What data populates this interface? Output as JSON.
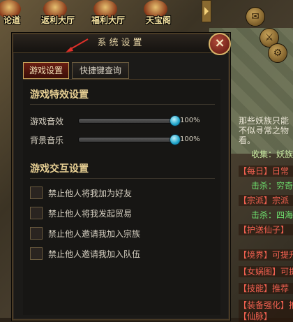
{
  "top_menu": {
    "items": [
      {
        "label": "论道"
      },
      {
        "label": "返利大厅"
      },
      {
        "label": "福利大厅"
      },
      {
        "label": "天宝阁"
      }
    ]
  },
  "side_panel": {
    "lines": [
      {
        "text": "那些妖族只能",
        "color": "#e9e4d4"
      },
      {
        "text": "不似寻常之物",
        "color": "#e9e4d4"
      },
      {
        "text": "看。",
        "color": "#e9e4d4"
      },
      {
        "text": "收集：妖族",
        "color": "#c8e8a0"
      },
      {
        "text": "【每日】日常",
        "color": "#f06050"
      },
      {
        "text": "击杀：穷奇",
        "color": "#6ee06e"
      },
      {
        "text": "【宗派】宗派",
        "color": "#f06050"
      },
      {
        "text": "击杀：四海",
        "color": "#6ee06e"
      },
      {
        "text": "【护送仙子】",
        "color": "#f06050"
      },
      {
        "text": "【境界】可提升",
        "color": "#f06050"
      },
      {
        "text": "【女娲图】可提升",
        "color": "#f06050"
      },
      {
        "text": "【技能】推荐",
        "color": "#f06050"
      },
      {
        "text": "【装备强化】推荐",
        "color": "#f06050"
      },
      {
        "text": "【仙脉】",
        "color": "#f06050"
      }
    ]
  },
  "dialog": {
    "title": "系统设置",
    "close_glyph": "×",
    "tabs": [
      {
        "label": "游戏设置",
        "active": true
      },
      {
        "label": "快捷键查询",
        "active": false
      }
    ],
    "effects_section": {
      "title": "游戏特效设置",
      "sliders": [
        {
          "label": "游戏音效",
          "value": 100,
          "value_text": "100%"
        },
        {
          "label": "背景音乐",
          "value": 100,
          "value_text": "100%"
        }
      ]
    },
    "interaction_section": {
      "title": "游戏交互设置",
      "options": [
        {
          "label": "禁止他人将我加为好友",
          "checked": false
        },
        {
          "label": "禁止他人将我发起贸易",
          "checked": false
        },
        {
          "label": "禁止他人邀请我加入宗族",
          "checked": false
        },
        {
          "label": "禁止他人邀请我加入队伍",
          "checked": false
        }
      ]
    }
  },
  "colors": {
    "accent_gold": "#e7cf93",
    "tab_active": "#6a1e12",
    "slider_knob": "#1ea3c8",
    "annotation_red": "#e0302a"
  }
}
